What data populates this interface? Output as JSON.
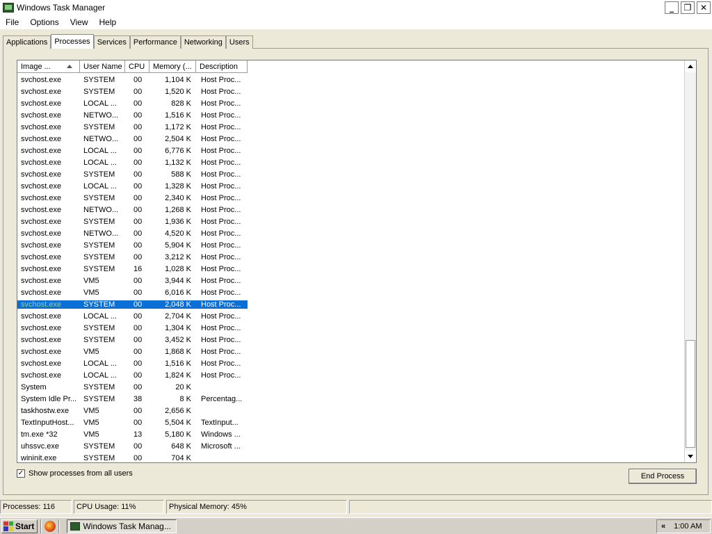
{
  "window": {
    "title": "Windows Task Manager"
  },
  "menu": [
    "File",
    "Options",
    "View",
    "Help"
  ],
  "tabs": [
    "Applications",
    "Processes",
    "Services",
    "Performance",
    "Networking",
    "Users"
  ],
  "active_tab": "Processes",
  "columns": [
    "Image ...",
    "User Name",
    "CPU",
    "Memory (...",
    "Description"
  ],
  "rows": [
    {
      "image": "svchost.exe",
      "user": "SYSTEM",
      "cpu": "00",
      "mem": "1,104 K",
      "desc": "Host Proc..."
    },
    {
      "image": "svchost.exe",
      "user": "SYSTEM",
      "cpu": "00",
      "mem": "1,520 K",
      "desc": "Host Proc..."
    },
    {
      "image": "svchost.exe",
      "user": "LOCAL ...",
      "cpu": "00",
      "mem": "828 K",
      "desc": "Host Proc..."
    },
    {
      "image": "svchost.exe",
      "user": "NETWO...",
      "cpu": "00",
      "mem": "1,516 K",
      "desc": "Host Proc..."
    },
    {
      "image": "svchost.exe",
      "user": "SYSTEM",
      "cpu": "00",
      "mem": "1,172 K",
      "desc": "Host Proc..."
    },
    {
      "image": "svchost.exe",
      "user": "NETWO...",
      "cpu": "00",
      "mem": "2,504 K",
      "desc": "Host Proc..."
    },
    {
      "image": "svchost.exe",
      "user": "LOCAL ...",
      "cpu": "00",
      "mem": "6,776 K",
      "desc": "Host Proc..."
    },
    {
      "image": "svchost.exe",
      "user": "LOCAL ...",
      "cpu": "00",
      "mem": "1,132 K",
      "desc": "Host Proc..."
    },
    {
      "image": "svchost.exe",
      "user": "SYSTEM",
      "cpu": "00",
      "mem": "588 K",
      "desc": "Host Proc..."
    },
    {
      "image": "svchost.exe",
      "user": "LOCAL ...",
      "cpu": "00",
      "mem": "1,328 K",
      "desc": "Host Proc..."
    },
    {
      "image": "svchost.exe",
      "user": "SYSTEM",
      "cpu": "00",
      "mem": "2,340 K",
      "desc": "Host Proc..."
    },
    {
      "image": "svchost.exe",
      "user": "NETWO...",
      "cpu": "00",
      "mem": "1,268 K",
      "desc": "Host Proc..."
    },
    {
      "image": "svchost.exe",
      "user": "SYSTEM",
      "cpu": "00",
      "mem": "1,936 K",
      "desc": "Host Proc..."
    },
    {
      "image": "svchost.exe",
      "user": "NETWO...",
      "cpu": "00",
      "mem": "4,520 K",
      "desc": "Host Proc..."
    },
    {
      "image": "svchost.exe",
      "user": "SYSTEM",
      "cpu": "00",
      "mem": "5,904 K",
      "desc": "Host Proc..."
    },
    {
      "image": "svchost.exe",
      "user": "SYSTEM",
      "cpu": "00",
      "mem": "3,212 K",
      "desc": "Host Proc..."
    },
    {
      "image": "svchost.exe",
      "user": "SYSTEM",
      "cpu": "16",
      "mem": "1,028 K",
      "desc": "Host Proc..."
    },
    {
      "image": "svchost.exe",
      "user": "VM5",
      "cpu": "00",
      "mem": "3,944 K",
      "desc": "Host Proc..."
    },
    {
      "image": "svchost.exe",
      "user": "VM5",
      "cpu": "00",
      "mem": "6,016 K",
      "desc": "Host Proc..."
    },
    {
      "image": "svchost.exe",
      "user": "SYSTEM",
      "cpu": "00",
      "mem": "2,048 K",
      "desc": "Host Proc...",
      "selected": true
    },
    {
      "image": "svchost.exe",
      "user": "LOCAL ...",
      "cpu": "00",
      "mem": "2,704 K",
      "desc": "Host Proc..."
    },
    {
      "image": "svchost.exe",
      "user": "SYSTEM",
      "cpu": "00",
      "mem": "1,304 K",
      "desc": "Host Proc..."
    },
    {
      "image": "svchost.exe",
      "user": "SYSTEM",
      "cpu": "00",
      "mem": "3,452 K",
      "desc": "Host Proc..."
    },
    {
      "image": "svchost.exe",
      "user": "VM5",
      "cpu": "00",
      "mem": "1,868 K",
      "desc": "Host Proc..."
    },
    {
      "image": "svchost.exe",
      "user": "LOCAL ...",
      "cpu": "00",
      "mem": "1,516 K",
      "desc": "Host Proc..."
    },
    {
      "image": "svchost.exe",
      "user": "LOCAL ...",
      "cpu": "00",
      "mem": "1,824 K",
      "desc": "Host Proc..."
    },
    {
      "image": "System",
      "user": "SYSTEM",
      "cpu": "00",
      "mem": "20 K",
      "desc": ""
    },
    {
      "image": "System Idle Pr...",
      "user": "SYSTEM",
      "cpu": "38",
      "mem": "8 K",
      "desc": "Percentag..."
    },
    {
      "image": "taskhostw.exe",
      "user": "VM5",
      "cpu": "00",
      "mem": "2,656 K",
      "desc": ""
    },
    {
      "image": "TextInputHost...",
      "user": "VM5",
      "cpu": "00",
      "mem": "5,504 K",
      "desc": "TextInput..."
    },
    {
      "image": "tm.exe *32",
      "user": "VM5",
      "cpu": "13",
      "mem": "5,180 K",
      "desc": "Windows ..."
    },
    {
      "image": "uhssvc.exe",
      "user": "SYSTEM",
      "cpu": "00",
      "mem": "648 K",
      "desc": "Microsoft ..."
    },
    {
      "image": "wininit.exe",
      "user": "SYSTEM",
      "cpu": "00",
      "mem": "704 K",
      "desc": ""
    }
  ],
  "show_all": {
    "label": "Show processes from all users",
    "checked": true
  },
  "end_process_label": "End Process",
  "status": {
    "processes": "Processes: 116",
    "cpu": "CPU Usage: 11%",
    "memory": "Physical Memory: 45%"
  },
  "taskbar": {
    "start_label": "Start",
    "task_label": "Windows Task Manag...",
    "clock": "1:00 AM",
    "tray_chevron": "«"
  },
  "colors": {
    "selection": "#0a6fd6",
    "face": "#ece9d8"
  },
  "icons": {
    "app": "task-manager-icon",
    "browser": "firefox-icon"
  }
}
